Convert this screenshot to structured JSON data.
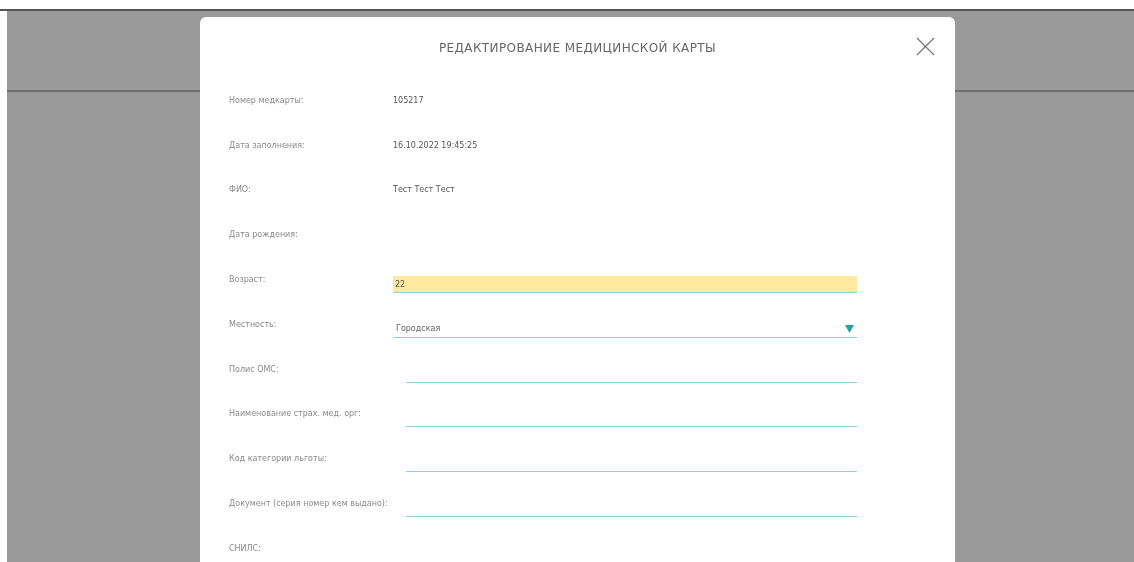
{
  "dialog": {
    "title": "РЕДАКТИРОВАНИЕ МЕДИЦИНСКОЙ КАРТЫ",
    "fields": [
      {
        "label": "Номер медкарты:",
        "kind": "text",
        "value": "105217"
      },
      {
        "label": "Дата заполнения:",
        "kind": "text",
        "value": "16.10.2022 19:45:25"
      },
      {
        "label": "ФИО:",
        "kind": "text",
        "value": "Тест Тест Тест"
      },
      {
        "label": "Дата рождения:",
        "kind": "text"
      },
      {
        "label": "Возраст:",
        "kind": "input",
        "value": "22",
        "highlighted": true
      },
      {
        "label": "Местность:",
        "kind": "select",
        "value": "Городская"
      },
      {
        "label": "Полис ОМС:",
        "kind": "input",
        "highlighted": false
      },
      {
        "label": "Наименование страх. мед. орг:",
        "kind": "input",
        "highlighted": false
      },
      {
        "label": "Код категории льготы:",
        "kind": "input",
        "highlighted": false
      },
      {
        "label": "Документ (серия номер кем выдано):",
        "kind": "input",
        "highlighted": false
      },
      {
        "label": "СНИЛС:",
        "kind": "text"
      }
    ]
  }
}
